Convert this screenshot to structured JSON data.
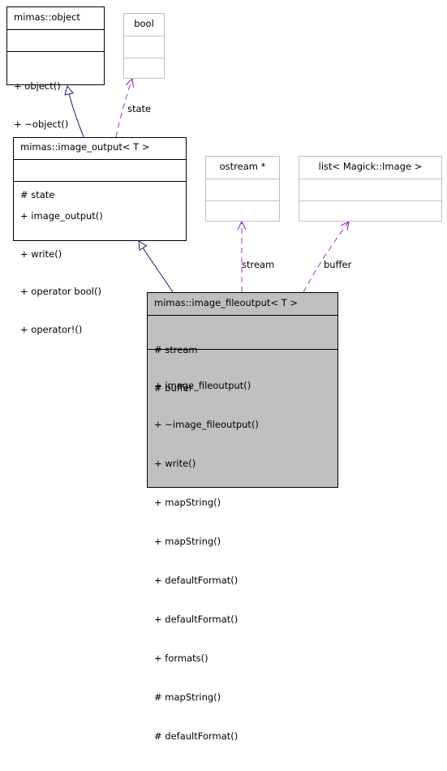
{
  "diagram": {
    "classes": {
      "object": {
        "name": "mimas::object",
        "attributes": [],
        "methods": [
          "+ object()",
          "+ ~object()"
        ]
      },
      "bool": {
        "name": "bool",
        "attributes": [],
        "methods": []
      },
      "image_output": {
        "name": "mimas::image_output< T >",
        "attributes": [
          "# state"
        ],
        "methods": [
          "+ image_output()",
          "+ write()",
          "+ operator bool()",
          "+ operator!()"
        ]
      },
      "ostream": {
        "name": "ostream *",
        "attributes": [],
        "methods": []
      },
      "list_image": {
        "name": "list< Magick::Image >",
        "attributes": [],
        "methods": []
      },
      "image_fileoutput": {
        "name": "mimas::image_fileoutput< T >",
        "attributes": [
          "# stream",
          "# buffer"
        ],
        "methods": [
          "+ image_fileoutput()",
          "+ ~image_fileoutput()",
          "+ write()",
          "+ mapString()",
          "+ mapString()",
          "+ defaultFormat()",
          "+ defaultFormat()",
          "+ formats()",
          "# mapString()",
          "# defaultFormat()"
        ]
      }
    },
    "edges": [
      {
        "from": "image_output",
        "to": "object",
        "type": "inheritance",
        "label": ""
      },
      {
        "from": "image_output",
        "to": "bool",
        "type": "usage",
        "label": "state"
      },
      {
        "from": "image_fileoutput",
        "to": "image_output",
        "type": "inheritance",
        "label": ""
      },
      {
        "from": "image_fileoutput",
        "to": "ostream",
        "type": "usage",
        "label": "stream"
      },
      {
        "from": "image_fileoutput",
        "to": "list_image",
        "type": "usage",
        "label": "buffer"
      }
    ],
    "colors": {
      "inheritance": "#191970",
      "usage": "#9a32cd",
      "focus_fill": "#bfbfbf",
      "external_border": "#bfbfbf"
    }
  }
}
